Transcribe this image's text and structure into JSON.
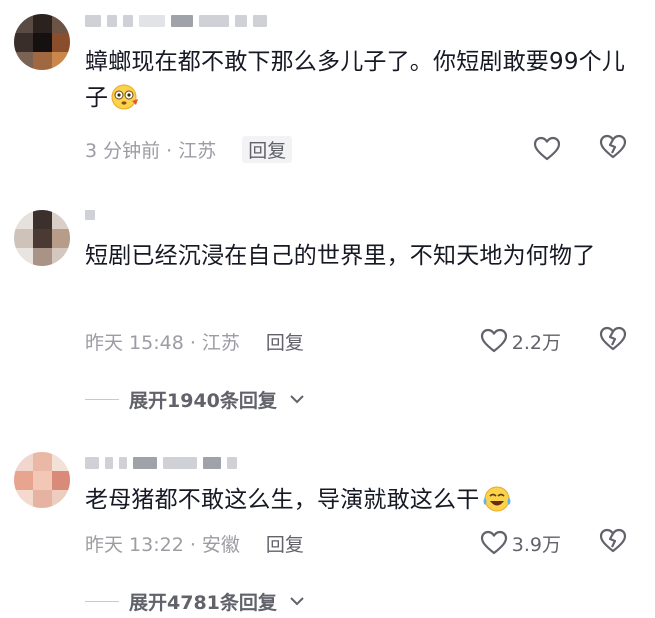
{
  "comments": [
    {
      "text": "蟑螂现在都不敢下那么多儿子了。你短剧敢要99个儿子",
      "emoji": "flushed-face-emoji",
      "time": "3 分钟前 · 江苏",
      "reply_label": "回复",
      "likes": "",
      "expand": ""
    },
    {
      "text": "短剧已经沉浸在自己的世界里，不知天地为何物了",
      "emoji": "",
      "time": "昨天 15:48 · 江苏",
      "reply_label": "回复",
      "likes": "2.2万",
      "expand": "展开1940条回复"
    },
    {
      "text": "老母猪都不敢这么生，导演就敢这么干",
      "emoji": "crying-laughing-emoji",
      "time": "昨天 13:22 · 安徽",
      "reply_label": "回复",
      "likes": "3.9万",
      "expand": "展开4781条回复"
    }
  ],
  "colors": {
    "text": "#161823",
    "meta": "#9c9ca3",
    "icon_stroke": "#61626a"
  },
  "icons": [
    "heart-outline-icon",
    "broken-heart-icon",
    "chevron-down-icon"
  ]
}
